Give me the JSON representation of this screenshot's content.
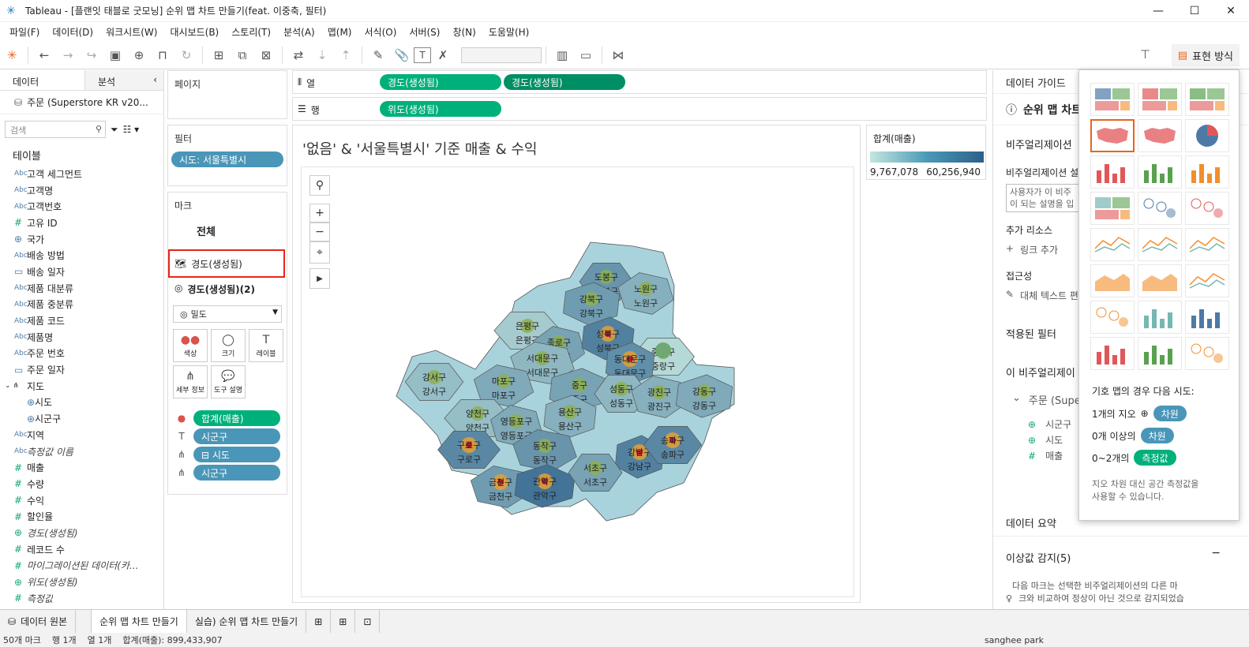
{
  "window": {
    "title": "Tableau - [플랜잇 태블로 굿모닝] 순위 맵 차트 만들기(feat. 이중축, 필터)",
    "minimize": "—",
    "maximize": "☐",
    "close": "✕"
  },
  "menu": [
    "파일(F)",
    "데이터(D)",
    "워크시트(W)",
    "대시보드(B)",
    "스토리(T)",
    "분석(A)",
    "맵(M)",
    "서식(O)",
    "서버(S)",
    "창(N)",
    "도움말(H)"
  ],
  "toolbar": {
    "show_me_label": "표현 방식"
  },
  "data_pane": {
    "tab_data": "데이터",
    "tab_analysis": "분석",
    "datasource": "주문 (Superstore KR v20...",
    "search_placeholder": "검색",
    "tables_heading": "테이블",
    "fields": [
      {
        "type": "abc",
        "name": "고객 세그먼트"
      },
      {
        "type": "abc",
        "name": "고객명"
      },
      {
        "type": "abc",
        "name": "고객번호"
      },
      {
        "type": "num",
        "name": "고유 ID"
      },
      {
        "type": "dim",
        "name": "국가"
      },
      {
        "type": "abc",
        "name": "배송 방법"
      },
      {
        "type": "date",
        "name": "배송 일자"
      },
      {
        "type": "abc",
        "name": "제품 대분류"
      },
      {
        "type": "abc",
        "name": "제품 중분류"
      },
      {
        "type": "abc",
        "name": "제품 코드"
      },
      {
        "type": "abc",
        "name": "제품명"
      },
      {
        "type": "abc",
        "name": "주문 번호"
      },
      {
        "type": "date",
        "name": "주문 일자"
      },
      {
        "type": "group",
        "name": "지도"
      },
      {
        "type": "geo-sub",
        "name": "시도"
      },
      {
        "type": "geo-sub",
        "name": "시군구"
      },
      {
        "type": "abc",
        "name": "지역"
      },
      {
        "type": "abc-it",
        "name": "측정값 이름"
      },
      {
        "type": "num",
        "name": "매출"
      },
      {
        "type": "num",
        "name": "수량"
      },
      {
        "type": "num",
        "name": "수익"
      },
      {
        "type": "num",
        "name": "할인율"
      },
      {
        "type": "geo-it",
        "name": "경도(생성됨)"
      },
      {
        "type": "num",
        "name": "레코드 수"
      },
      {
        "type": "num-it",
        "name": "마이그레이션된 데이터(카..."
      },
      {
        "type": "geo-it",
        "name": "위도(생성됨)"
      },
      {
        "type": "num-it",
        "name": "측정값"
      }
    ]
  },
  "pages": {
    "title": "페이지"
  },
  "filters": {
    "title": "필터",
    "pill": "시도: 서울특별시"
  },
  "marks": {
    "title": "마크",
    "all": "전체",
    "layer1": "경도(생성됨)",
    "layer2": "경도(생성됨)(2)",
    "mark_type": "밀도",
    "buttons": [
      {
        "icon": "●●",
        "label": "색상"
      },
      {
        "icon": "◯",
        "label": "크기"
      },
      {
        "icon": "T",
        "label": "레이블"
      },
      {
        "icon": "⋔",
        "label": "세부 정보"
      },
      {
        "icon": "💬",
        "label": "도구 설명"
      }
    ],
    "fields": [
      {
        "icon": "●",
        "label": "합계(매출)",
        "color": "green"
      },
      {
        "icon": "T",
        "label": "시군구",
        "color": "blue"
      },
      {
        "icon": "⋔",
        "label": "⊟ 시도",
        "color": "blue"
      },
      {
        "icon": "⋔",
        "label": "시군구",
        "color": "blue"
      }
    ]
  },
  "shelves": {
    "columns_label": "열",
    "rows_label": "행",
    "columns": [
      "경도(생성됨)",
      "경도(생성됨)"
    ],
    "rows": [
      "위도(생성됨)"
    ]
  },
  "viz": {
    "title": "'없음' & '서울특별시' 기준 매출 & 수익",
    "districts": [
      {
        "name": "도봉구",
        "shade": 0.6,
        "hot": false
      },
      {
        "name": "노원구",
        "shade": 0.4,
        "hot": false
      },
      {
        "name": "강북구",
        "shade": 0.55,
        "hot": false
      },
      {
        "name": "은평구",
        "shade": 0.2,
        "hot": false
      },
      {
        "name": "종로구",
        "shade": 0.5,
        "hot": false
      },
      {
        "name": "성북구",
        "shade": 0.75,
        "hot": true
      },
      {
        "name": "중랑구",
        "shade": 0.1,
        "hot": false
      },
      {
        "name": "서대문구",
        "shade": 0.35,
        "hot": false
      },
      {
        "name": "동대문구",
        "shade": 0.65,
        "hot": true
      },
      {
        "name": "강서구",
        "shade": 0.3,
        "hot": false
      },
      {
        "name": "마포구",
        "shade": 0.45,
        "hot": false
      },
      {
        "name": "중구",
        "shade": 0.5,
        "hot": false
      },
      {
        "name": "성동구",
        "shade": 0.35,
        "hot": false
      },
      {
        "name": "광진구",
        "shade": 0.4,
        "hot": false
      },
      {
        "name": "강동구",
        "shade": 0.45,
        "hot": false
      },
      {
        "name": "양천구",
        "shade": 0.3,
        "hot": false
      },
      {
        "name": "영등포구",
        "shade": 0.45,
        "hot": false
      },
      {
        "name": "용산구",
        "shade": 0.4,
        "hot": false
      },
      {
        "name": "구로구",
        "shade": 0.7,
        "hot": true
      },
      {
        "name": "동작구",
        "shade": 0.6,
        "hot": false
      },
      {
        "name": "강남구",
        "shade": 0.75,
        "hot": true
      },
      {
        "name": "송파구",
        "shade": 0.7,
        "hot": true
      },
      {
        "name": "금천구",
        "shade": 0.55,
        "hot": true
      },
      {
        "name": "관악구",
        "shade": 0.85,
        "hot": true
      },
      {
        "name": "서초구",
        "shade": 0.5,
        "hot": false
      }
    ]
  },
  "legend": {
    "title": "합계(매출)",
    "min": "9,767,078",
    "max": "60,256,940"
  },
  "guide": {
    "title": "데이터 가이드",
    "chart_heading": "순위 맵 차트",
    "viz_desc_heading": "비주얼리제이션",
    "viz_desc_label": "비주얼리제이션 설",
    "viz_desc_placeholder_1": "사용자가 이 비주",
    "viz_desc_placeholder_2": "이 되는 설명을 입",
    "extra_resources": "추가 리소스",
    "add_link": "링크 추가",
    "accessibility": "접근성",
    "alt_text": "대체 텍스트 편",
    "applied_filters": "적용된 필터",
    "this_viz": "이 비주얼리제이",
    "order_source": "주문 (Supe",
    "fields": [
      "시군구",
      "시도",
      "매출"
    ],
    "data_summary": "데이터 요약",
    "outliers": "이상값 감지(5)",
    "outliers_desc_1": "다음 마크는 선택한 비주얼리제이션의 다른 마",
    "outliers_desc_2": "크와 비교하여 정상이 아닌 것으로 감지되었습"
  },
  "show_me": {
    "hint": "기호 맵의 경우 다음 시도:",
    "req1_prefix": "1개의 지오",
    "req1_pill": "차원",
    "req2_prefix": "0개 이상의",
    "req2_pill": "차원",
    "req3_prefix": "0~2개의",
    "req3_pill": "측정값",
    "note_1": "지오 차원 대신 공간 측정값을",
    "note_2": "사용할 수 있습니다."
  },
  "tabs": {
    "source": "데이터 원본",
    "sheets": [
      "순위 맵 차트 만들기",
      "실습) 순위 맵 차트 만들기"
    ]
  },
  "status": {
    "marks": "50개 마크",
    "rows": "행 1개",
    "cols": "열 1개",
    "sum": "합계(매출): 899,433,907",
    "user": "sanghee park"
  }
}
